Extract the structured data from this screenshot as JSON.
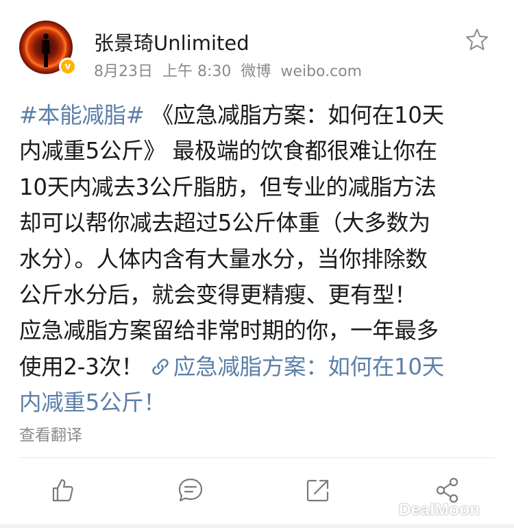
{
  "post": {
    "author": "张景琦Unlimited",
    "verified_badge": "v",
    "date": "8月23日",
    "time": "上午 8:30",
    "source_app": "微博",
    "source_site": "weibo.com",
    "content_lines": [
      [
        {
          "text": "#本能减脂#",
          "style": "blue"
        },
        {
          "text": " 《应急减脂方案：如何在10天",
          "style": "normal"
        }
      ],
      [
        {
          "text": "内减重5公斤》 最极端的饮食都很难让你在",
          "style": "normal"
        }
      ],
      [
        {
          "text": "10天内减去3公斤脂肪，但专业的减脂方法",
          "style": "normal"
        }
      ],
      [
        {
          "text": "却可以帮你减去超过5公斤体重（大多数为",
          "style": "normal"
        }
      ],
      [
        {
          "text": "水分）。人体内含有大量水分，当你排除数",
          "style": "normal"
        }
      ],
      [
        {
          "text": "公斤水分后，就会变得更精瘦、更有型！",
          "style": "normal"
        }
      ],
      [
        {
          "text": "应急减脂方案留给非常时期的你，一年最多",
          "style": "normal"
        }
      ],
      [
        {
          "text": "使用2-3次！ ",
          "style": "normal"
        },
        {
          "text": "__link_icon__",
          "style": "icon"
        },
        {
          "text": "应急减脂方案：如何在10天",
          "style": "blue"
        }
      ],
      [
        {
          "text": "内减重5公斤！",
          "style": "blue"
        }
      ]
    ],
    "translate_label": "查看翻译"
  },
  "actions": [
    {
      "name": "like-icon",
      "label": "like"
    },
    {
      "name": "comment-icon",
      "label": "comment"
    },
    {
      "name": "share-icon",
      "label": "share"
    },
    {
      "name": "more-share-icon",
      "label": "more"
    }
  ],
  "watermark": "DealMoon",
  "colors": {
    "link_blue": "#5b7fa9",
    "meta_gray": "#8a8a8a",
    "badge_orange": "#ffb300",
    "icon_gray": "#8a8a8a"
  },
  "icons": [
    "star-icon",
    "verified-badge-icon",
    "link-icon",
    "like-icon",
    "comment-icon",
    "share-icon",
    "more-share-icon"
  ]
}
